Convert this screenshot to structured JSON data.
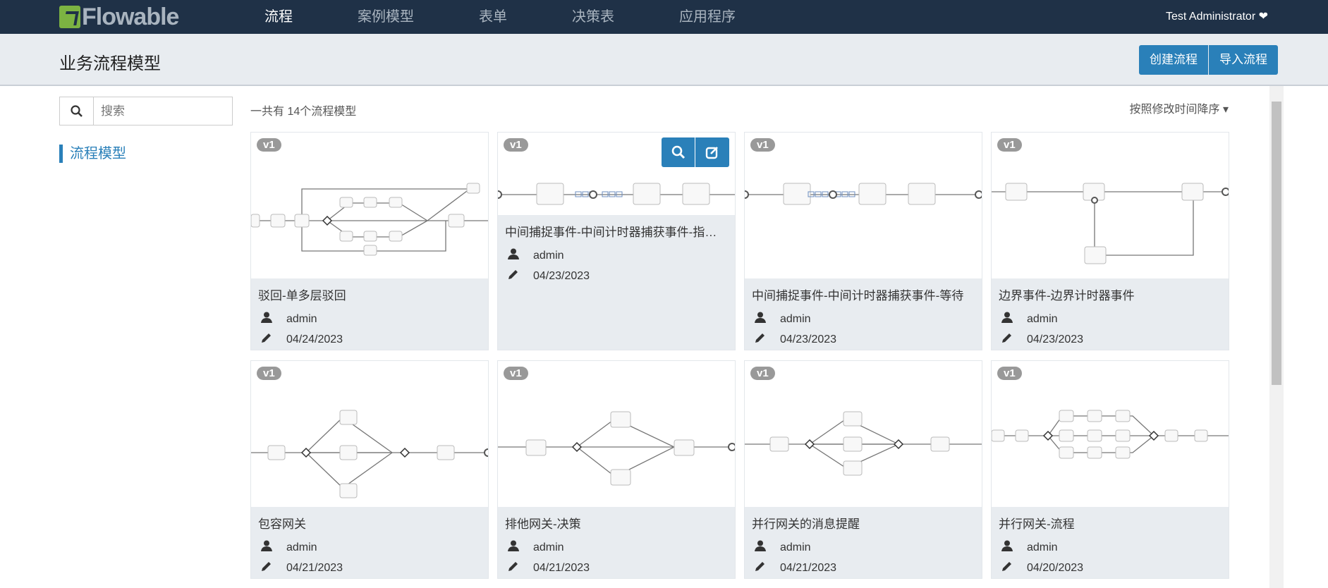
{
  "header": {
    "logo": "Flowable",
    "nav": [
      {
        "label": "流程",
        "active": true
      },
      {
        "label": "案例模型"
      },
      {
        "label": "表单"
      },
      {
        "label": "决策表"
      },
      {
        "label": "应用程序"
      }
    ],
    "user": "Test Administrator ❤"
  },
  "subheader": {
    "title": "业务流程模型",
    "create_label": "创建流程",
    "import_label": "导入流程"
  },
  "sidebar": {
    "search_placeholder": "搜索",
    "link": "流程模型"
  },
  "main": {
    "count": "一共有 14个流程模型",
    "sort": "按照修改时间降序 ▾",
    "cards": [
      {
        "version": "v1",
        "title": "驳回-单多层驳回",
        "user": "admin",
        "date": "04/24/2023"
      },
      {
        "version": "v1",
        "title": "中间捕捉事件-中间计时器捕获事件-指定时间",
        "user": "admin",
        "date": "04/23/2023",
        "hover": true
      },
      {
        "version": "v1",
        "title": "中间捕捉事件-中间计时器捕获事件-等待",
        "user": "admin",
        "date": "04/23/2023"
      },
      {
        "version": "v1",
        "title": "边界事件-边界计时器事件",
        "user": "admin",
        "date": "04/23/2023"
      },
      {
        "version": "v1",
        "title": "包容网关",
        "user": "admin",
        "date": "04/21/2023"
      },
      {
        "version": "v1",
        "title": "排他网关-决策",
        "user": "admin",
        "date": "04/21/2023"
      },
      {
        "version": "v1",
        "title": "并行网关的消息提醒",
        "user": "admin",
        "date": "04/21/2023"
      },
      {
        "version": "v1",
        "title": "并行网关-流程",
        "user": "admin",
        "date": "04/20/2023"
      }
    ]
  },
  "colors": {
    "nav_bg": "#1f3147",
    "accent": "#2a80b9",
    "logo_green": "#7cb342",
    "footer_bg": "#e8ecf0"
  }
}
